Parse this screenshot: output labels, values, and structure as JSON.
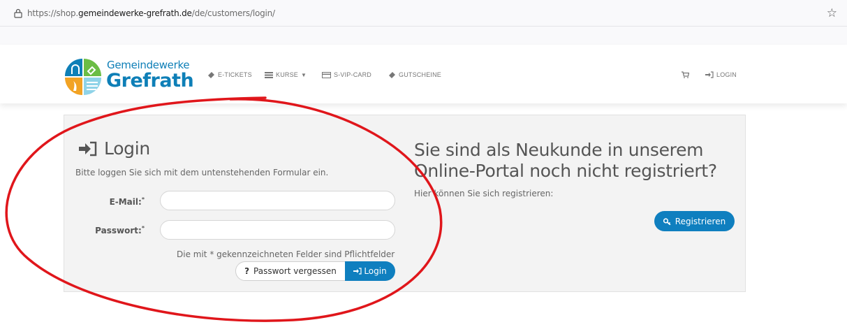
{
  "browser": {
    "url_prefix": "https://shop.",
    "url_domain": "gemeindewerke-grefrath.de",
    "url_path": "/de/customers/login/"
  },
  "header": {
    "logo_line1": "Gemeindewerke",
    "logo_line2": "Grefrath",
    "nav": {
      "etickets": "E-TICKETS",
      "kurse": "KURSE",
      "svip": "S-VIP-CARD",
      "gutscheine": "GUTSCHEINE",
      "login": "LOGIN"
    }
  },
  "login": {
    "title": "Login",
    "subtitle": "Bitte loggen Sie sich mit dem untenstehenden Formular ein.",
    "email_label": "E-Mail:",
    "password_label": "Passwort:",
    "required_marker": "*",
    "required_note": "Die mit * gekennzeichneten Felder sind Pflichtfelder",
    "forgot_label": "Passwort vergessen",
    "login_button": "Login"
  },
  "register": {
    "title": "Sie sind als Neukunde in unserem Online-Portal noch nicht registriert?",
    "subtitle": "Hier können Sie sich registrieren:",
    "button": "Registrieren"
  },
  "colors": {
    "brand_blue": "#0f7fbf",
    "annotation_red": "#e0161b",
    "panel_bg": "#f3f3f3"
  }
}
